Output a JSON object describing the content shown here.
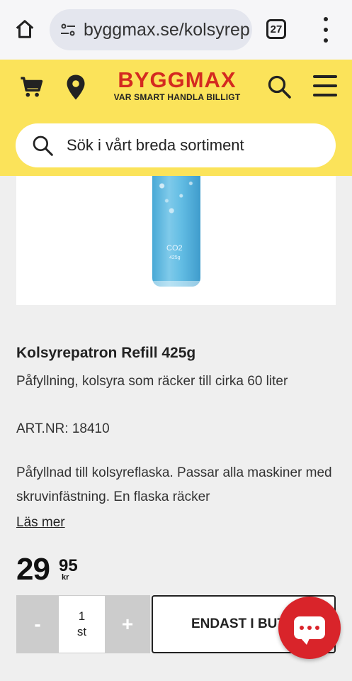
{
  "browser": {
    "url": "byggmax.se/kolsyrep",
    "tab_count": "27"
  },
  "header": {
    "logo": "BYGGMAX",
    "tagline": "VAR SMART HANDLA BILLIGT",
    "search_placeholder": "Sök i vårt breda sortiment"
  },
  "product": {
    "image_label": "CO2",
    "image_weight": "425g",
    "title": "Kolsyrepatron Refill 425g",
    "subtitle": "Påfyllning, kolsyra som räcker till cirka 60 liter",
    "art_nr": "ART.NR: 18410",
    "description": "Påfyllnad till kolsyreflaska. Passar alla maskiner med skruvinfästning. En flaska räcker",
    "read_more": "Läs mer",
    "price_int": "29",
    "price_dec": "95",
    "currency": "kr"
  },
  "purchase": {
    "minus": "-",
    "qty": "1",
    "unit": "st",
    "plus": "+",
    "buy_label": "ENDAST I BUTIK"
  },
  "colors": {
    "header_bg": "#fbe35a",
    "logo_red": "#d42a20",
    "chat_red": "#d9242a"
  }
}
